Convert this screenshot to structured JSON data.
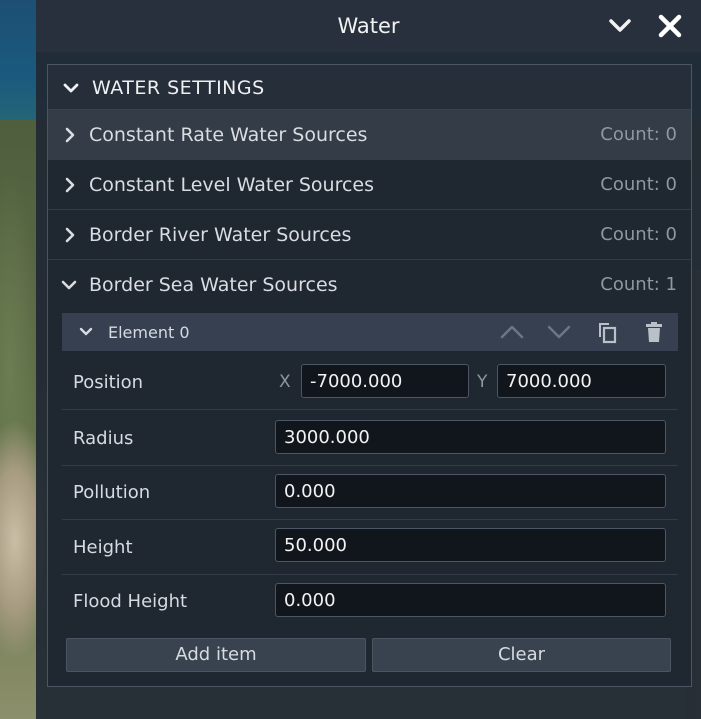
{
  "window": {
    "title": "Water"
  },
  "section": {
    "title": "WATER SETTINGS"
  },
  "categories": [
    {
      "label": "Constant Rate Water Sources",
      "count": "Count: 0"
    },
    {
      "label": "Constant Level Water Sources",
      "count": "Count: 0"
    },
    {
      "label": "Border River Water Sources",
      "count": "Count: 0"
    },
    {
      "label": "Border Sea Water Sources",
      "count": "Count: 1"
    }
  ],
  "element": {
    "title": "Element 0",
    "position": {
      "label": "Position",
      "x_label": "X",
      "x_value": "-7000.000",
      "y_label": "Y",
      "y_value": "7000.000"
    },
    "radius": {
      "label": "Radius",
      "value": "3000.000"
    },
    "pollution": {
      "label": "Pollution",
      "value": "0.000"
    },
    "height": {
      "label": "Height",
      "value": "50.000"
    },
    "flood_height": {
      "label": "Flood Height",
      "value": "0.000"
    }
  },
  "actions": {
    "add_item": "Add item",
    "clear": "Clear"
  },
  "colors": {
    "panel_bg": "#212934",
    "field_bg": "#11161c",
    "text": "#d6dbe1",
    "count": "#8e97a2"
  }
}
